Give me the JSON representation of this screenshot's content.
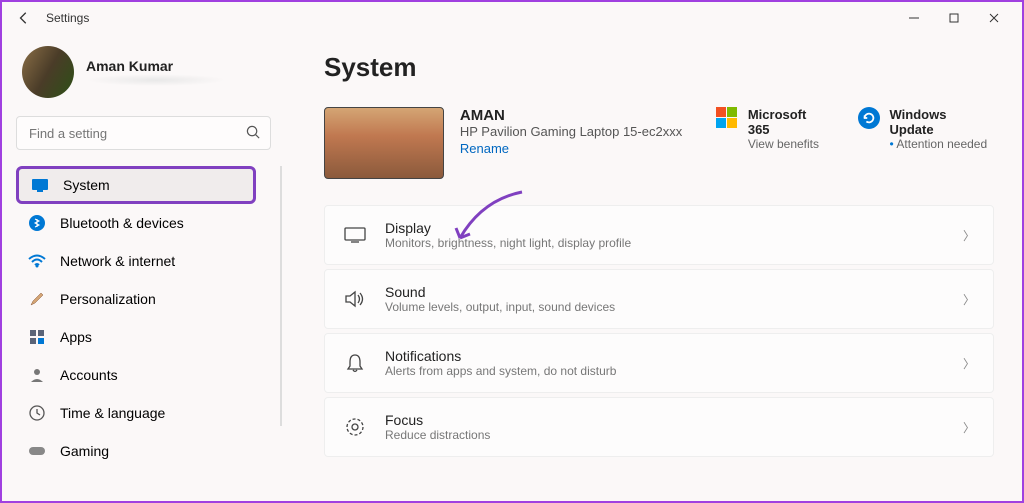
{
  "window": {
    "title": "Settings"
  },
  "profile": {
    "name": "Aman Kumar"
  },
  "search": {
    "placeholder": "Find a setting"
  },
  "nav": [
    {
      "label": "System",
      "active": true
    },
    {
      "label": "Bluetooth & devices"
    },
    {
      "label": "Network & internet"
    },
    {
      "label": "Personalization"
    },
    {
      "label": "Apps"
    },
    {
      "label": "Accounts"
    },
    {
      "label": "Time & language"
    },
    {
      "label": "Gaming"
    }
  ],
  "page": {
    "title": "System"
  },
  "device": {
    "name": "AMAN",
    "model": "HP Pavilion Gaming Laptop 15-ec2xxx",
    "rename": "Rename"
  },
  "quick": {
    "m365": {
      "title": "Microsoft 365",
      "sub": "View benefits"
    },
    "wu": {
      "title": "Windows Update",
      "sub": "Attention needed"
    }
  },
  "items": [
    {
      "title": "Display",
      "desc": "Monitors, brightness, night light, display profile"
    },
    {
      "title": "Sound",
      "desc": "Volume levels, output, input, sound devices"
    },
    {
      "title": "Notifications",
      "desc": "Alerts from apps and system, do not disturb"
    },
    {
      "title": "Focus",
      "desc": "Reduce distractions"
    }
  ]
}
